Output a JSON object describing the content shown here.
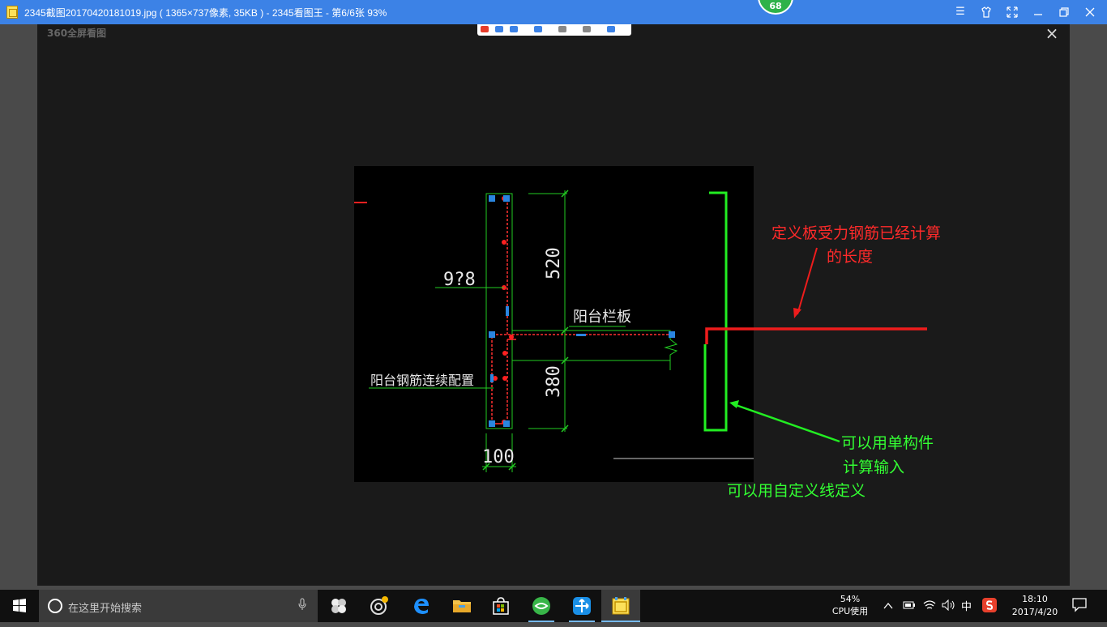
{
  "window": {
    "title": "2345截图20170420181019.jpg ( 1365×737像素, 35KB ) - 2345看图王 - 第6/6张 93%",
    "badge": "68"
  },
  "viewer": {
    "brand": "360全屏看图",
    "close": "×"
  },
  "drawing": {
    "dim_520": "520",
    "dim_380": "380",
    "dim_100": "100",
    "rebar_label": "9?8",
    "balcony_panel": "阳台栏板",
    "balcony_config": "阳台钢筋连续配置"
  },
  "annotations": {
    "red_line1": "定义板受力钢筋已经计算",
    "red_line2": "的长度",
    "green_line1": "可以用单构件",
    "green_line2": "计算输入",
    "green_line3": "可以用自定义线定义"
  },
  "taskbar": {
    "search_placeholder": "在这里开始搜索",
    "cpu_percent": "54%",
    "cpu_label": "CPU使用",
    "ime": "中",
    "time": "18:10",
    "date": "2017/4/20"
  },
  "colors": {
    "titlebar": "#3c82e6",
    "annotation_red": "#ff2a2a",
    "annotation_green": "#33ff33",
    "cad_green": "#22cc22"
  }
}
